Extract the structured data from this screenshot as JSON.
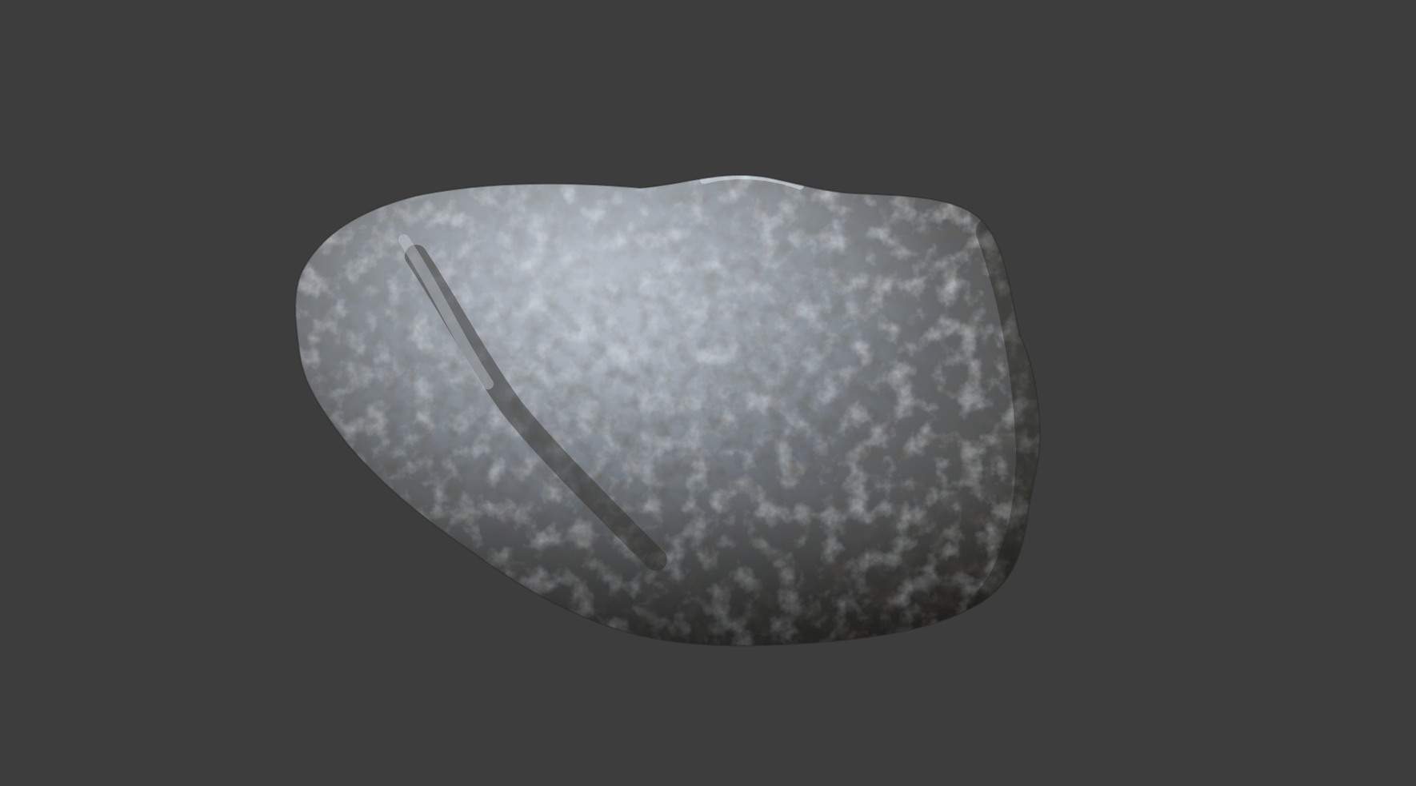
{
  "scene": {
    "background_color": "#3d3d3d",
    "subject": "rock-model",
    "rock_colors": {
      "highlight": "#c9d4df",
      "mid": "#7b8189",
      "shadow": "#2e2c28",
      "warm_tint": "#8c8060"
    }
  }
}
